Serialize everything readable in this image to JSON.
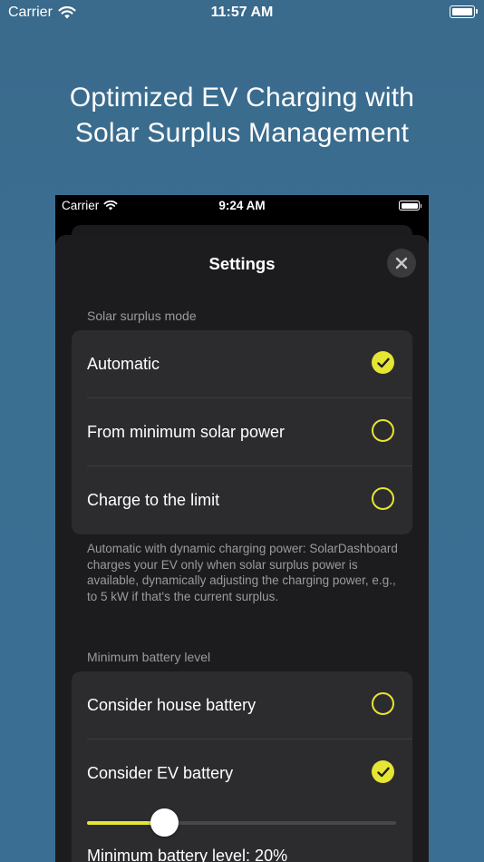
{
  "outer_status": {
    "carrier": "Carrier",
    "time": "11:57 AM"
  },
  "headline": {
    "line1": "Optimized EV Charging with",
    "line2": "Solar Surplus Management"
  },
  "inner_status": {
    "carrier": "Carrier",
    "time": "9:24 AM"
  },
  "sheet": {
    "title": "Settings",
    "solar_section": {
      "label": "Solar surplus mode",
      "options": [
        {
          "label": "Automatic",
          "selected": true
        },
        {
          "label": "From minimum solar power",
          "selected": false
        },
        {
          "label": "Charge to the limit",
          "selected": false
        }
      ],
      "footnote": "Automatic with dynamic charging power: SolarDashboard charges your EV only when solar surplus power is available, dynamically adjusting the charging power, e.g., to 5 kW if that's the current surplus."
    },
    "battery_section": {
      "label": "Minimum battery level",
      "options": [
        {
          "label": "Consider house battery",
          "selected": false
        },
        {
          "label": "Consider EV battery",
          "selected": true
        }
      ],
      "slider_value_fraction": 0.25,
      "min_level_label": "Minimum battery level: 20%"
    }
  },
  "colors": {
    "accent": "#e5e534",
    "sheet_bg": "#1c1c1e",
    "group_bg": "#2c2c2e",
    "background_blue": "#3b6f92"
  },
  "icons": [
    "wifi-icon",
    "battery-icon",
    "close-icon",
    "checkmark-icon"
  ]
}
